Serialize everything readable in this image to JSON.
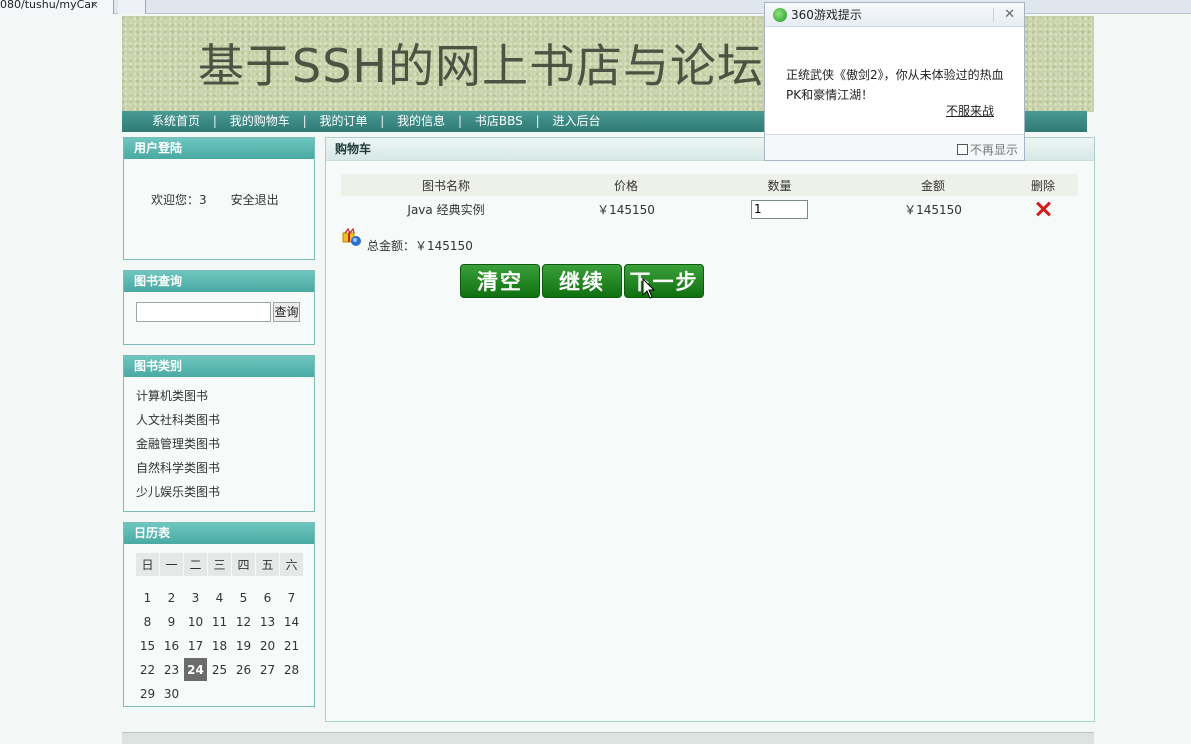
{
  "browser": {
    "tab_title": "080/tushu/myCar",
    "tab_close": "×"
  },
  "banner": {
    "title": "基于SSH的网上书店与论坛"
  },
  "nav": {
    "items": [
      "系统首页",
      "我的购物车",
      "我的订单",
      "我的信息",
      "书店BBS",
      "进入后台"
    ],
    "separator": "|"
  },
  "login": {
    "title": "用户登陆",
    "welcome": "欢迎您：3",
    "logout": "安全退出"
  },
  "search": {
    "title": "图书查询",
    "value": "",
    "button": "查询"
  },
  "categories": {
    "title": "图书类别",
    "items": [
      "计算机类图书",
      "人文社科类图书",
      "金融管理类图书",
      "自然科学类图书",
      "少儿娱乐类图书"
    ]
  },
  "calendar": {
    "title": "日历表",
    "weekdays": [
      "日",
      "一",
      "二",
      "三",
      "四",
      "五",
      "六"
    ],
    "weeks": [
      [
        "1",
        "2",
        "3",
        "4",
        "5",
        "6",
        "7"
      ],
      [
        "8",
        "9",
        "10",
        "11",
        "12",
        "13",
        "14"
      ],
      [
        "15",
        "16",
        "17",
        "18",
        "19",
        "20",
        "21"
      ],
      [
        "22",
        "23",
        "24",
        "25",
        "26",
        "27",
        "28"
      ],
      [
        "29",
        "30",
        "",
        "",
        "",
        "",
        ""
      ]
    ],
    "today": "24"
  },
  "cart": {
    "title": "购物车",
    "columns": [
      "图书名称",
      "价格",
      "数量",
      "金额",
      "删除"
    ],
    "rows": [
      {
        "name": "Java 经典实例",
        "price": "￥145150",
        "quantity": "1",
        "amount": "￥145150"
      }
    ],
    "total_label": "总金额：",
    "total_value": "￥145150",
    "buttons": {
      "clear": "清空",
      "continue": "继续",
      "next": "下一步"
    }
  },
  "popup": {
    "title": "360游戏提示",
    "close": "✕",
    "message": "正统武侠《傲剑2》，你从未体验过的热血PK和豪情江湖！",
    "link": "不服来战",
    "checkbox_label": "不再显示"
  },
  "colors": {
    "nav_bg": "#3a8a84",
    "box_head": "#5bb7b0",
    "button_green": "#1e8a1e",
    "delete_red": "#d41a1a"
  }
}
